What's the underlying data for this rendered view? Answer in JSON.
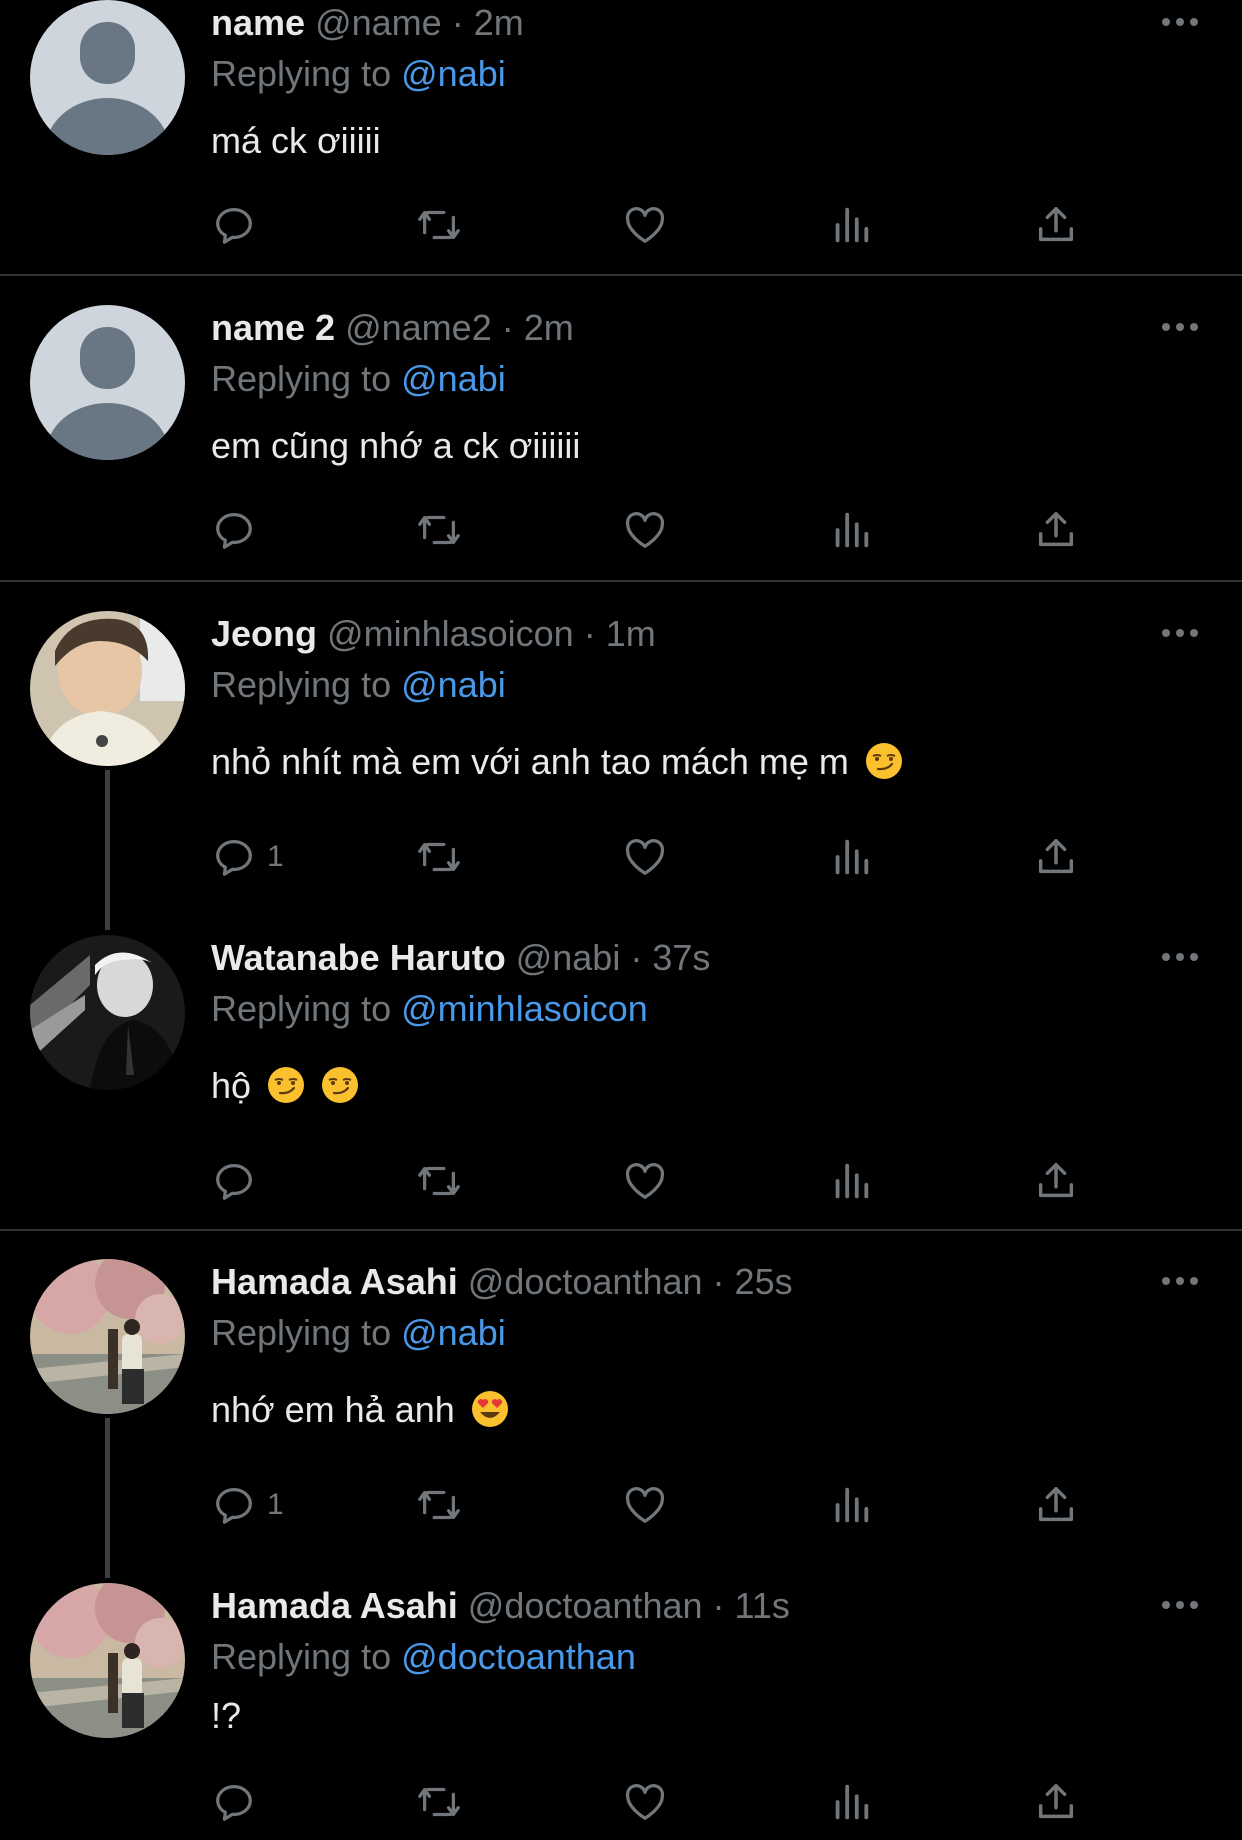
{
  "tweets": [
    {
      "name": "name",
      "handle": "@name",
      "time": "2m",
      "replying_label": "Replying to",
      "replying_to": "@nabi",
      "text": "má ck ơiiiii",
      "emojis": [],
      "reply_count": "",
      "avatar": "default-avatar-icon"
    },
    {
      "name": "name 2",
      "handle": "@name2",
      "time": "2m",
      "replying_label": "Replying to",
      "replying_to": "@nabi",
      "text": "em cũng nhớ a ck ơiiiiii",
      "emojis": [],
      "reply_count": "",
      "avatar": "default-avatar-icon"
    },
    {
      "name": "Jeong",
      "handle": "@minhlasoicon",
      "time": "1m",
      "replying_label": "Replying to",
      "replying_to": "@nabi",
      "text": "nhỏ nhít mà em với anh tao mách mẹ m",
      "emojis": [
        "smirk"
      ],
      "reply_count": "1",
      "avatar": "user-photo"
    },
    {
      "name": "Watanabe Haruto",
      "handle": "@nabi",
      "time": "37s",
      "replying_label": "Replying to",
      "replying_to": "@minhlasoicon",
      "text": "hộ",
      "emojis": [
        "smirk",
        "smirk"
      ],
      "reply_count": "",
      "avatar": "user-photo"
    },
    {
      "name": "Hamada Asahi",
      "handle": "@doctoanthan",
      "time": "25s",
      "replying_label": "Replying to",
      "replying_to": "@nabi",
      "text": "nhớ em hả anh",
      "emojis": [
        "heart-eyes"
      ],
      "reply_count": "1",
      "avatar": "user-photo"
    },
    {
      "name": "Hamada Asahi",
      "handle": "@doctoanthan",
      "time": "11s",
      "replying_label": "Replying to",
      "replying_to": "@doctoanthan",
      "text": "!?",
      "emojis": [],
      "reply_count": "",
      "avatar": "user-photo"
    }
  ],
  "separator": "·",
  "colors": {
    "background": "#000000",
    "text": "#e7e9ea",
    "muted": "#71767b",
    "mention": "#4a99e9",
    "divider": "#2f3336"
  },
  "icons": {
    "reply": "reply-icon",
    "retweet": "retweet-icon",
    "like": "heart-icon",
    "views": "views-icon",
    "share": "share-icon",
    "more": "more-icon"
  }
}
